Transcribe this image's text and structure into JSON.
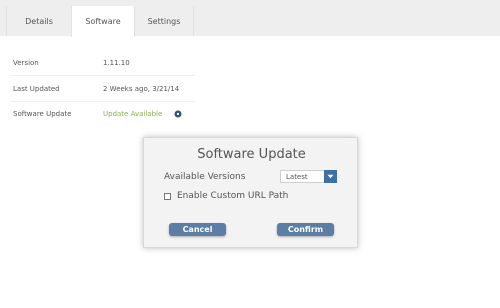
{
  "tabs": [
    {
      "label": "Details",
      "active": false
    },
    {
      "label": "Software",
      "active": true
    },
    {
      "label": "Settings",
      "active": false
    }
  ],
  "info": {
    "version_label": "Version",
    "version_value": "1.11.10",
    "last_updated_label": "Last Updated",
    "last_updated_value": "2 Weeks ago, 3/21/14",
    "software_update_label": "Software Update",
    "software_update_value": "Update Available",
    "status_icon": "dark-dot-icon"
  },
  "dialog": {
    "title": "Software Update",
    "versions_label": "Available Versions",
    "versions_selected": "Latest",
    "custom_url_label": "Enable Custom URL Path",
    "custom_url_checked": false,
    "cancel_label": "Cancel",
    "confirm_label": "Confirm"
  },
  "colors": {
    "button": "#5c7ea6",
    "select_arrow": "#3f6fa8",
    "link": "#8ab04a",
    "tabbar": "#eeeeee"
  }
}
